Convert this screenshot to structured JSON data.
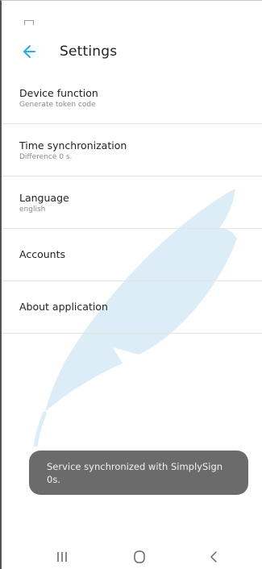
{
  "header": {
    "title": "Settings",
    "back_icon": "arrow-left-icon",
    "accent_color": "#2aaee0"
  },
  "settings": {
    "items": [
      {
        "label": "Device function",
        "sublabel": "Generate token code"
      },
      {
        "label": "Time synchronization",
        "sublabel": "Difference 0 s."
      },
      {
        "label": "Language",
        "sublabel": "english"
      },
      {
        "label": "Accounts"
      },
      {
        "label": "About application"
      }
    ]
  },
  "toast": {
    "message": "Service synchronized with SimplySign 0s."
  },
  "navbar": {
    "recents_icon": "recent-apps-icon",
    "home_icon": "home-icon",
    "back_icon": "back-chevron-icon"
  },
  "watermark": {
    "icon": "feather-icon",
    "color": "#dcedf8"
  }
}
